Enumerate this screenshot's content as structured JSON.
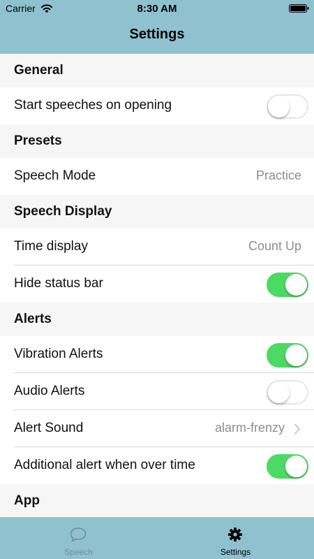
{
  "status_bar": {
    "carrier": "Carrier",
    "time": "8:30 AM",
    "icons": [
      "wifi-icon",
      "battery-icon"
    ]
  },
  "nav": {
    "title": "Settings"
  },
  "sections": {
    "general": {
      "header": "General",
      "start_speeches": {
        "label": "Start speeches on opening",
        "toggle_on": false
      }
    },
    "presets": {
      "header": "Presets",
      "speech_mode": {
        "label": "Speech Mode",
        "value": "Practice"
      }
    },
    "speech_display": {
      "header": "Speech Display",
      "time_display": {
        "label": "Time display",
        "value": "Count Up"
      },
      "hide_status_bar": {
        "label": "Hide status bar",
        "toggle_on": true
      }
    },
    "alerts": {
      "header": "Alerts",
      "vibration": {
        "label": "Vibration Alerts",
        "toggle_on": true
      },
      "audio": {
        "label": "Audio Alerts",
        "toggle_on": false
      },
      "alert_sound": {
        "label": "Alert Sound",
        "value": "alarm-frenzy",
        "icon": "chevron-right-icon"
      },
      "additional": {
        "label": "Additional alert when over time",
        "toggle_on": true
      }
    },
    "app": {
      "header": "App"
    }
  },
  "tabbar": {
    "tabs": [
      {
        "label": "Speech",
        "icon": "speech-bubble-icon",
        "selected": false
      },
      {
        "label": "Settings",
        "icon": "gear-icon",
        "selected": true
      }
    ]
  },
  "colors": {
    "bar_background": "#8fc1cf",
    "toggle_on": "#4cd964",
    "secondary_text": "#8e8e93",
    "tab_selected": "#000000",
    "tab_unselected": "#6f8f98"
  }
}
